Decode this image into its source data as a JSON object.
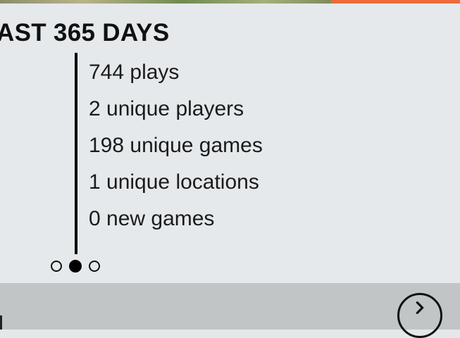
{
  "section": {
    "title": "AST 365 DAYS"
  },
  "stats": [
    {
      "label": "744 plays"
    },
    {
      "label": "2 unique players"
    },
    {
      "label": "198 unique games"
    },
    {
      "label": "1 unique locations"
    },
    {
      "label": "0 new games"
    }
  ],
  "pager": {
    "count": 3,
    "active_index": 1
  },
  "footer": {
    "next_icon": "chevron-right-icon"
  },
  "colors": {
    "background": "#e5e9eb",
    "footer_bar": "#c2c5c6",
    "accent": "#ec6a3c",
    "text": "#111111"
  }
}
